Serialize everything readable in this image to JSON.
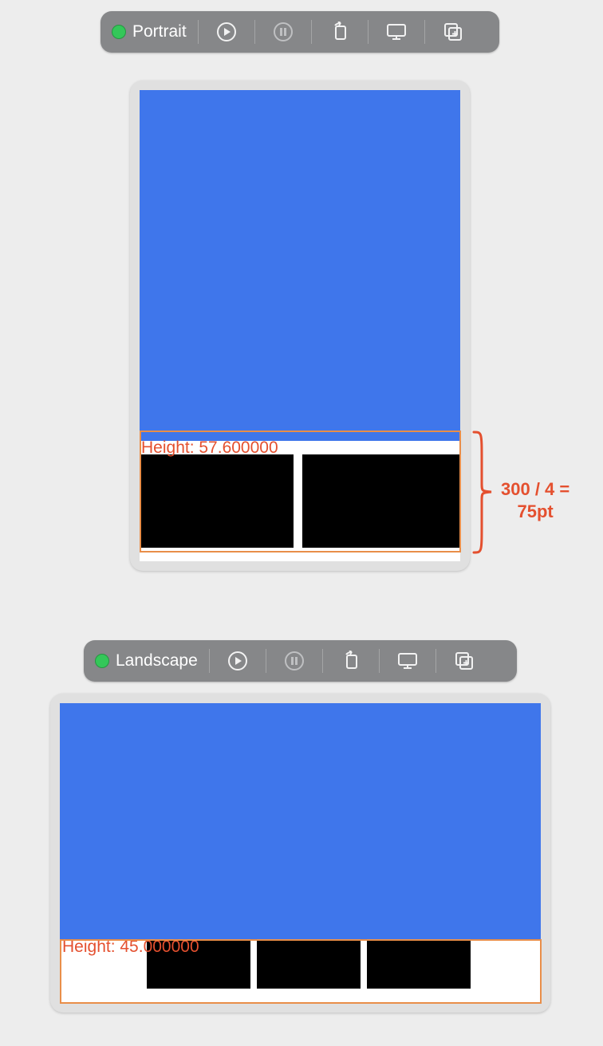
{
  "portrait": {
    "toolbar_title": "Portrait",
    "height_label": "Height: 57.600000",
    "annotation_line1": "300 / 4 =",
    "annotation_line2": "75pt"
  },
  "landscape": {
    "toolbar_title": "Landscape",
    "height_label": "Height: 45.000000"
  },
  "icons": {
    "play": "play-in-circle-icon",
    "pause": "pause-in-circle-icon",
    "rotate": "rotate-device-icon",
    "display": "external-display-icon",
    "stack": "add-window-icon"
  },
  "colors": {
    "toolbar_bg": "#868789",
    "status_green": "#34c759",
    "canvas_blue": "#3f76eb",
    "annotation_red": "#e4502f",
    "outline_orange": "#e98e49"
  }
}
